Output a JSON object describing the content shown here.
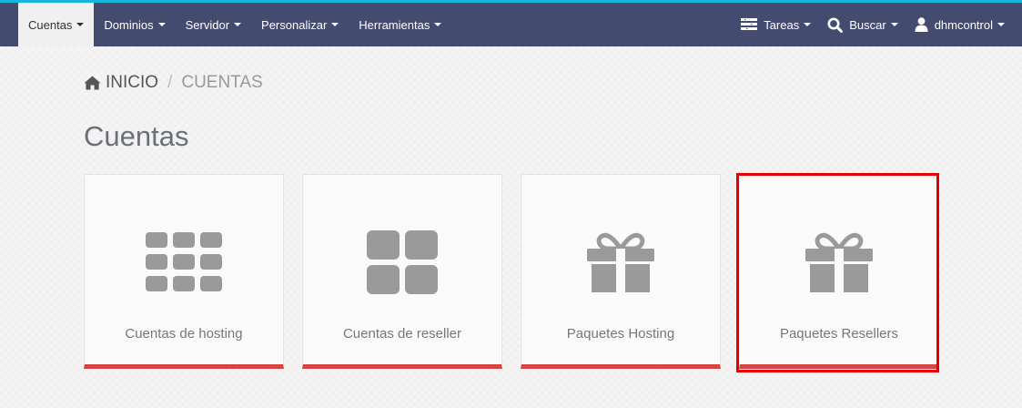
{
  "nav": {
    "left": [
      {
        "label": "Cuentas",
        "active": true
      },
      {
        "label": "Dominios",
        "active": false
      },
      {
        "label": "Servidor",
        "active": false
      },
      {
        "label": "Personalizar",
        "active": false
      },
      {
        "label": "Herramientas",
        "active": false
      }
    ],
    "right": {
      "tasks": {
        "label": "Tareas",
        "icon": "tasks-icon"
      },
      "search": {
        "label": "Buscar",
        "icon": "search-icon"
      },
      "user": {
        "label": "dhmcontrol",
        "icon": "user-icon"
      }
    }
  },
  "breadcrumb": {
    "home": "INICIO",
    "separator": "/",
    "current": "CUENTAS"
  },
  "page_title": "Cuentas",
  "cards": [
    {
      "label": "Cuentas de hosting",
      "icon": "grid-nine-icon"
    },
    {
      "label": "Cuentas de reseller",
      "icon": "grid-four-icon"
    },
    {
      "label": "Paquetes Hosting",
      "icon": "gift-icon"
    },
    {
      "label": "Paquetes Resellers",
      "icon": "gift-icon",
      "highlighted": true
    }
  ],
  "colors": {
    "navbar": "#434b6f",
    "top_accent": "#16b6dc",
    "card_accent": "#d64541",
    "highlight": "#e40000",
    "icon": "#9a9a9a"
  }
}
